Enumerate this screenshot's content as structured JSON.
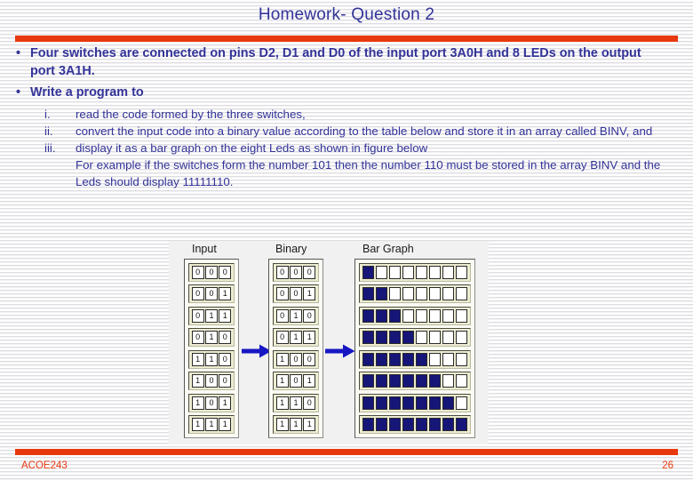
{
  "slide": {
    "title": "Homework- Question 2",
    "accent_color": "#e8380d",
    "text_color": "#333399",
    "bullet_glyph": "•"
  },
  "body": {
    "bullets": [
      "Four switches are connected on pins D2, D1 and D0 of the input port 3A0H and 8 LEDs on the output port 3A1H.",
      "Write a program to"
    ],
    "sub_items": [
      {
        "marker": "i.",
        "text": "read the code formed by the three switches,"
      },
      {
        "marker": "ii.",
        "text": "convert the input code into a binary value according to the table below and store it in an array called BINV, and"
      },
      {
        "marker": "iii.",
        "text": "display it as a bar graph on the eight Leds as shown in figure below"
      }
    ],
    "note": "For example if the switches form the number 101 then the number 110 must be stored in the array BINV and the Leds should display 11111110."
  },
  "figure": {
    "headers": {
      "input": "Input",
      "binary": "Binary",
      "bar_graph": "Bar Graph"
    },
    "arrow_color": "#1717c4",
    "led_on_color": "#161678",
    "led_off_color": "#ffffff",
    "rows": [
      {
        "input": [
          "0",
          "0",
          "0"
        ],
        "binary": [
          "0",
          "0",
          "0"
        ],
        "leds": [
          1,
          0,
          0,
          0,
          0,
          0,
          0,
          0
        ]
      },
      {
        "input": [
          "0",
          "0",
          "1"
        ],
        "binary": [
          "0",
          "0",
          "1"
        ],
        "leds": [
          1,
          1,
          0,
          0,
          0,
          0,
          0,
          0
        ]
      },
      {
        "input": [
          "0",
          "1",
          "1"
        ],
        "binary": [
          "0",
          "1",
          "0"
        ],
        "leds": [
          1,
          1,
          1,
          0,
          0,
          0,
          0,
          0
        ]
      },
      {
        "input": [
          "0",
          "1",
          "0"
        ],
        "binary": [
          "0",
          "1",
          "1"
        ],
        "leds": [
          1,
          1,
          1,
          1,
          0,
          0,
          0,
          0
        ]
      },
      {
        "input": [
          "1",
          "1",
          "0"
        ],
        "binary": [
          "1",
          "0",
          "0"
        ],
        "leds": [
          1,
          1,
          1,
          1,
          1,
          0,
          0,
          0
        ]
      },
      {
        "input": [
          "1",
          "0",
          "0"
        ],
        "binary": [
          "1",
          "0",
          "1"
        ],
        "leds": [
          1,
          1,
          1,
          1,
          1,
          1,
          0,
          0
        ]
      },
      {
        "input": [
          "1",
          "0",
          "1"
        ],
        "binary": [
          "1",
          "1",
          "0"
        ],
        "leds": [
          1,
          1,
          1,
          1,
          1,
          1,
          1,
          0
        ]
      },
      {
        "input": [
          "1",
          "1",
          "1"
        ],
        "binary": [
          "1",
          "1",
          "1"
        ],
        "leds": [
          1,
          1,
          1,
          1,
          1,
          1,
          1,
          1
        ]
      }
    ]
  },
  "footer": {
    "course_code": "ACOE243",
    "page_number": "26"
  }
}
